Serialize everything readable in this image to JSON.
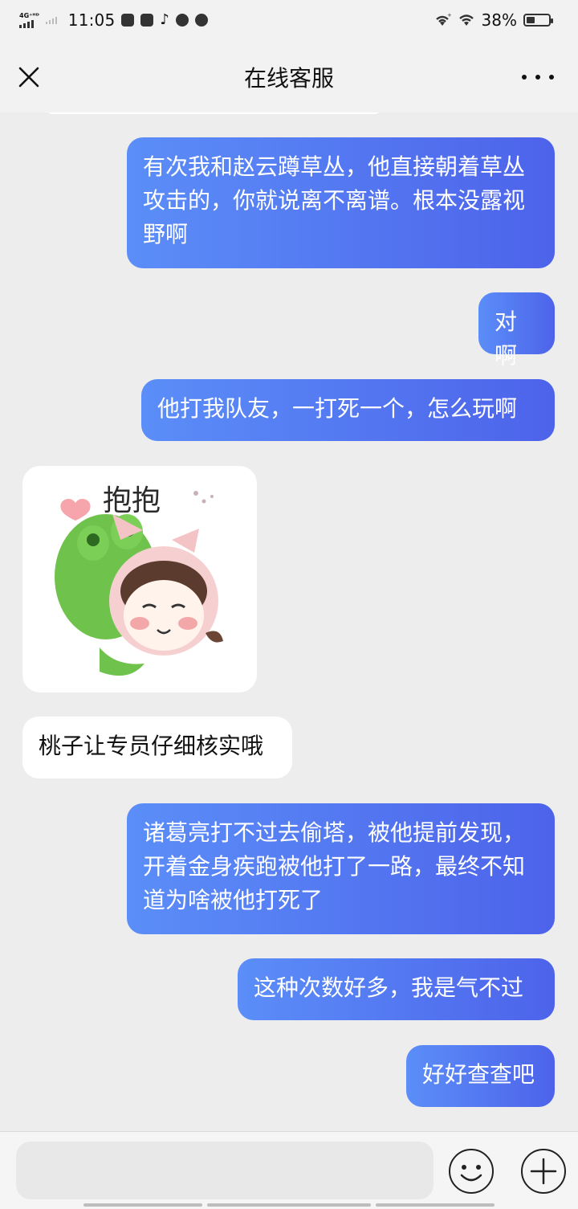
{
  "status_bar": {
    "network": "4G⁺ᴴᴰ",
    "time": "11:05",
    "battery": "38%",
    "battery_level": 0.38
  },
  "nav": {
    "title": "在线客服"
  },
  "messages": [
    {
      "side": "me",
      "text": "有次我和赵云蹲草丛，他直接朝着草丛攻击的，你就说离不离谱。根本没露视野啊"
    },
    {
      "side": "me",
      "text": "对啊"
    },
    {
      "side": "me",
      "text": "他打我队友，一打死一个，怎么玩啊"
    },
    {
      "side": "other",
      "type": "sticker",
      "text": "抱抱"
    },
    {
      "side": "other",
      "text": "桃子让专员仔细核实哦"
    },
    {
      "side": "me",
      "text": "诸葛亮打不过去偷塔，被他提前发现，开着金身疾跑被他打了一路，最终不知道为啥被他打死了"
    },
    {
      "side": "me",
      "text": "这种次数好多，我是气不过"
    },
    {
      "side": "me",
      "text": "好好查查吧"
    }
  ],
  "composer": {
    "placeholder": ""
  },
  "colors": {
    "bubble_me_start": "#5b8ef8",
    "bubble_me_end": "#4d63ea",
    "background": "#ededed"
  }
}
